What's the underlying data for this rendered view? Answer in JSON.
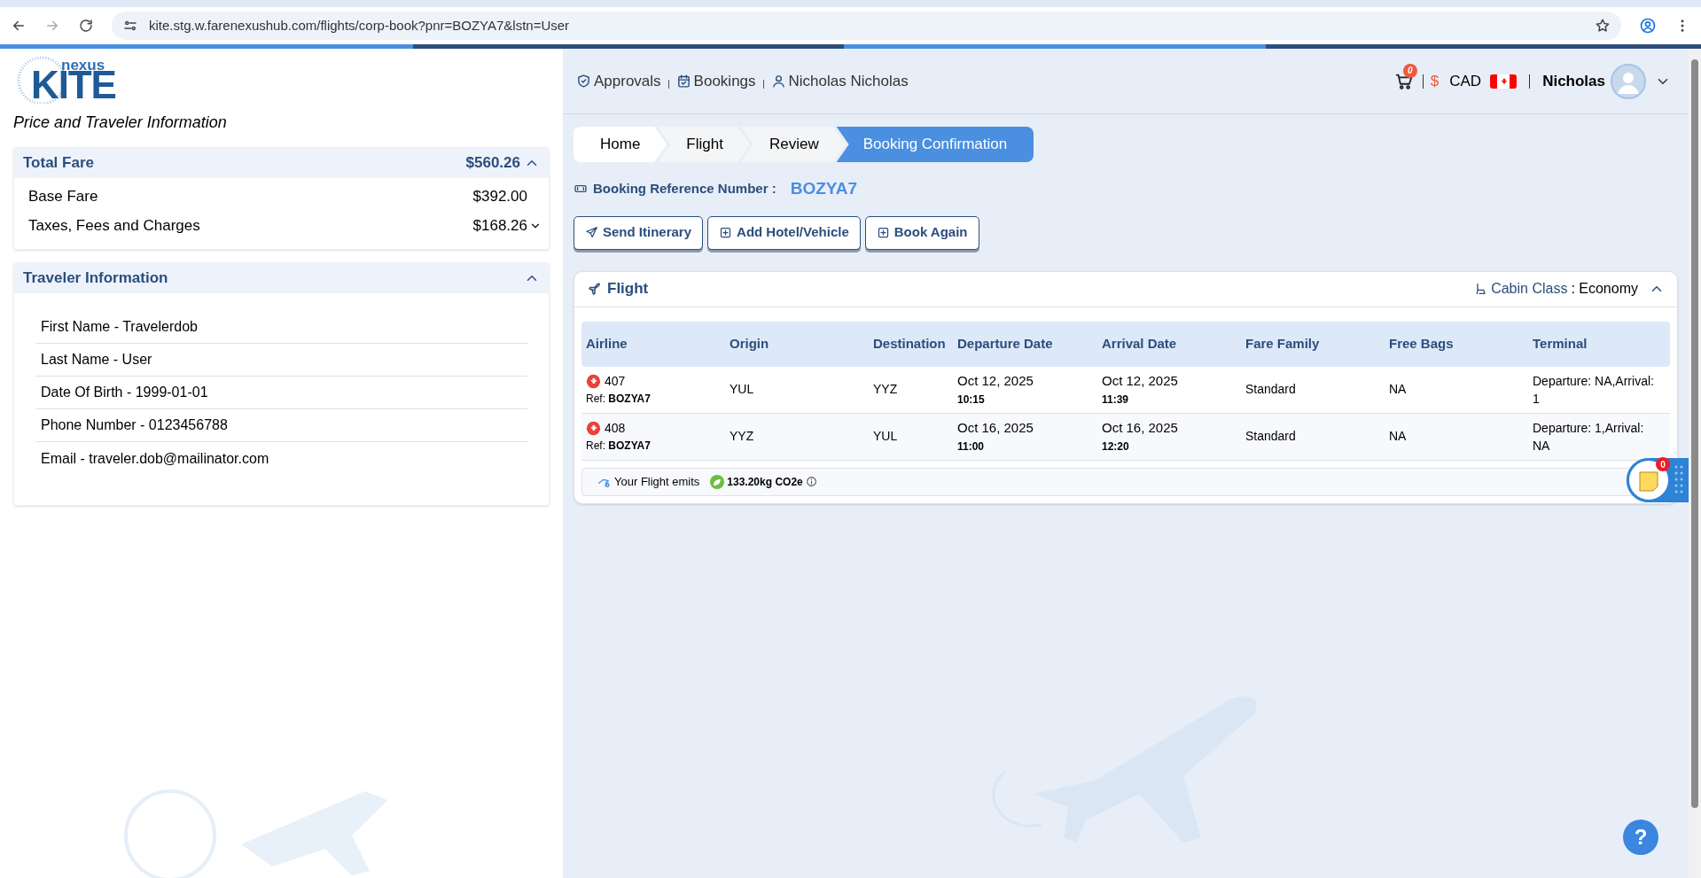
{
  "browser": {
    "url": "kite.stg.w.farenexushub.com/flights/corp-book?pnr=BOZYA7&lstn=User"
  },
  "logo": {
    "small": "nexus",
    "large": "KITE"
  },
  "left": {
    "heading": "Price and Traveler Information",
    "fare": {
      "title": "Total Fare",
      "total": "$560.26",
      "expanded": true,
      "items": [
        {
          "label": "Base Fare",
          "value": "$392.00",
          "kind": "plain"
        },
        {
          "label": "Taxes, Fees and Charges",
          "value": "$168.26",
          "kind": "dropdown"
        }
      ]
    },
    "traveler": {
      "title": "Traveler Information",
      "expanded": true,
      "fields": [
        "First Name - Travelerdob",
        "Last Name - User",
        "Date Of Birth - 1999-01-01",
        "Phone Number - 0123456788",
        "Email - traveler.dob@mailinator.com"
      ]
    }
  },
  "header": {
    "nav": [
      {
        "label": "Approvals",
        "kind": "shield"
      },
      {
        "label": "Bookings",
        "kind": "calendar"
      },
      {
        "label": "Nicholas Nicholas",
        "kind": "user"
      }
    ],
    "cart_count": "0",
    "currency_symbol": "$",
    "currency": "CAD",
    "user": "Nicholas"
  },
  "breadcrumb": [
    {
      "label": "Home",
      "selected": false
    },
    {
      "label": "Flight",
      "selected": false
    },
    {
      "label": "Review",
      "selected": false
    },
    {
      "label": "Booking Confirmation",
      "selected": true
    }
  ],
  "booking_ref": {
    "label": "Booking Reference Number :",
    "value": "BOZYA7"
  },
  "actions": [
    {
      "label": "Send Itinerary",
      "kind": "send"
    },
    {
      "label": "Add Hotel/Vehicle",
      "kind": "add"
    },
    {
      "label": "Book Again",
      "kind": "add"
    }
  ],
  "flight": {
    "title": "Flight",
    "cabin_label": "Cabin Class",
    "cabin_value": ": Economy",
    "expanded": true,
    "columns": [
      "Airline",
      "Origin",
      "Destination",
      "Departure Date",
      "Arrival Date",
      "Fare Family",
      "Free Bags",
      "Terminal"
    ],
    "rows": [
      {
        "flight": "407",
        "ref": "Ref: **BOZYA7**",
        "origin": "YUL",
        "destination": "YYZ",
        "dep_date": "Oct 12, 2025",
        "dep_time": "10:15",
        "arr_date": "Oct 12, 2025",
        "arr_time": "11:39",
        "fare_family": "Standard",
        "bags": "NA",
        "terminal": "Departure: NA,Arrival: 1"
      },
      {
        "flight": "408",
        "ref": "Ref: **BOZYA7**",
        "origin": "YYZ",
        "destination": "YUL",
        "dep_date": "Oct 16, 2025",
        "dep_time": "11:00",
        "arr_date": "Oct 16, 2025",
        "arr_time": "12:20",
        "fare_family": "Standard",
        "bags": "NA",
        "terminal": "Departure: 1,Arrival: NA"
      }
    ],
    "emissions": {
      "label": "Your Flight emits",
      "value": "133.20kg CO2e"
    }
  },
  "notes_widget": {
    "count": "0"
  },
  "help_button": {
    "label": "?"
  }
}
